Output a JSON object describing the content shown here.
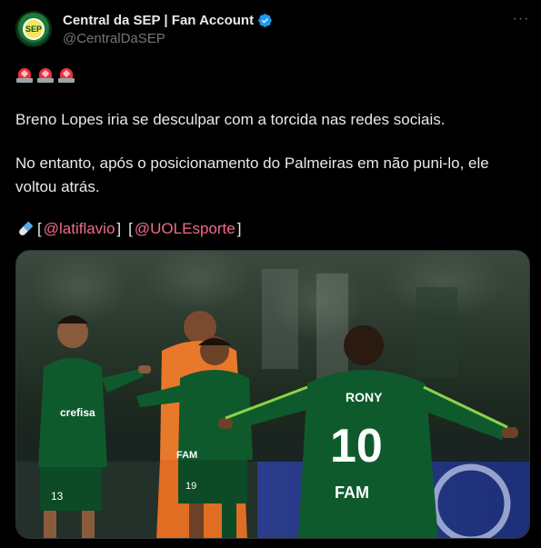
{
  "account": {
    "display_name": "Central da SEP | Fan Account",
    "handle": "@CentralDaSEP",
    "avatar_text": "SEP"
  },
  "more_label": "···",
  "tweet": {
    "line1": "Breno Lopes iria se desculpar com a torcida nas redes sociais.",
    "line2": "No entanto, após o posicionamento do Palmeiras em não puni-lo, ele voltou atrás.",
    "bracket_open_1": "[",
    "mention_1": "@latiflavio",
    "bracket_close_1": "]",
    "bracket_open_2": "[",
    "mention_2": "@UOLEsporte",
    "bracket_close_2": "]"
  },
  "photo": {
    "jersey_name": "RONY",
    "jersey_number": "10",
    "sponsor": "crefisa",
    "sleeve_sponsor": "FAM",
    "shorts_numbers": [
      "13",
      "19"
    ]
  },
  "colors": {
    "background": "#000000",
    "text": "#e7e9ea",
    "secondary": "#71767b",
    "mention": "#f06a8c",
    "verified": "#1d9bf0"
  },
  "icons": [
    "verified-badge-icon",
    "more-options-icon",
    "siren-icon",
    "pill-icon"
  ]
}
